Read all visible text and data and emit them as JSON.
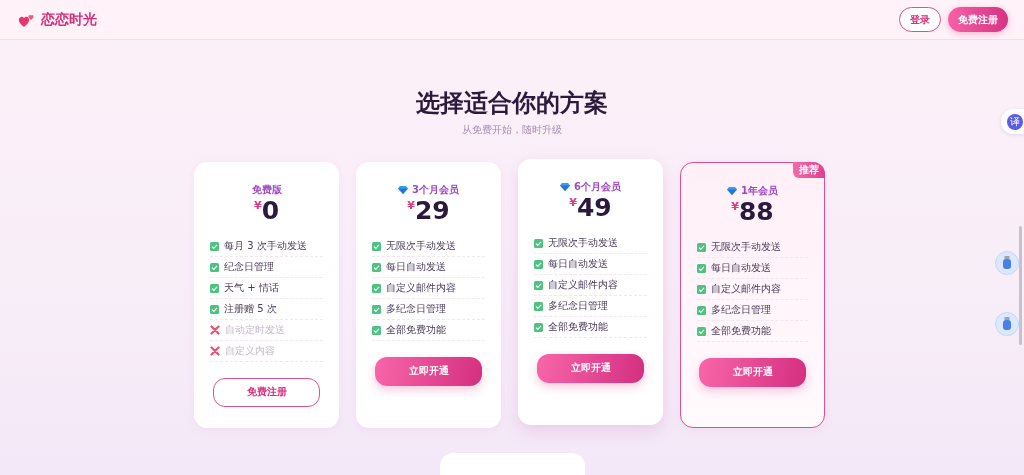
{
  "header": {
    "brand": "恋恋时光",
    "buttons": [
      {
        "label": "登录",
        "kind": "outline"
      },
      {
        "label": "免费注册",
        "kind": "filled"
      }
    ]
  },
  "hero": {
    "title": "选择适合你的方案",
    "subtitle": "从免费开始，随时升级"
  },
  "plans": [
    {
      "name": "免费版",
      "premium": false,
      "currency": "¥",
      "price": "0",
      "featured": false,
      "raised": false,
      "features": [
        {
          "text": "每月 3 次手动发送",
          "included": true
        },
        {
          "text": "纪念日管理",
          "included": true
        },
        {
          "text": "天气 + 情话",
          "included": true
        },
        {
          "text": "注册赠 5 次",
          "included": true
        },
        {
          "text": "自动定时发送",
          "included": false
        },
        {
          "text": "自定义内容",
          "included": false
        }
      ],
      "button": {
        "label": "免费注册",
        "kind": "outline"
      }
    },
    {
      "name": "3个月会员",
      "premium": true,
      "currency": "¥",
      "price": "29",
      "featured": false,
      "raised": false,
      "features": [
        {
          "text": "无限次手动发送",
          "included": true
        },
        {
          "text": "每日自动发送",
          "included": true
        },
        {
          "text": "自定义邮件内容",
          "included": true
        },
        {
          "text": "多纪念日管理",
          "included": true
        },
        {
          "text": "全部免费功能",
          "included": true
        }
      ],
      "button": {
        "label": "立即开通",
        "kind": "filled"
      }
    },
    {
      "name": "6个月会员",
      "premium": true,
      "currency": "¥",
      "price": "49",
      "featured": false,
      "raised": true,
      "features": [
        {
          "text": "无限次手动发送",
          "included": true
        },
        {
          "text": "每日自动发送",
          "included": true
        },
        {
          "text": "自定义邮件内容",
          "included": true
        },
        {
          "text": "多纪念日管理",
          "included": true
        },
        {
          "text": "全部免费功能",
          "included": true
        }
      ],
      "button": {
        "label": "立即开通",
        "kind": "filled"
      }
    },
    {
      "name": "1年会员",
      "premium": true,
      "currency": "¥",
      "price": "88",
      "featured": true,
      "badge": "推荐",
      "raised": false,
      "features": [
        {
          "text": "无限次手动发送",
          "included": true
        },
        {
          "text": "每日自动发送",
          "included": true
        },
        {
          "text": "自定义邮件内容",
          "included": true
        },
        {
          "text": "多纪念日管理",
          "included": true
        },
        {
          "text": "全部免费功能",
          "included": true
        }
      ],
      "button": {
        "label": "立即开通",
        "kind": "filled"
      }
    }
  ],
  "side": {
    "translate_label": "译"
  }
}
